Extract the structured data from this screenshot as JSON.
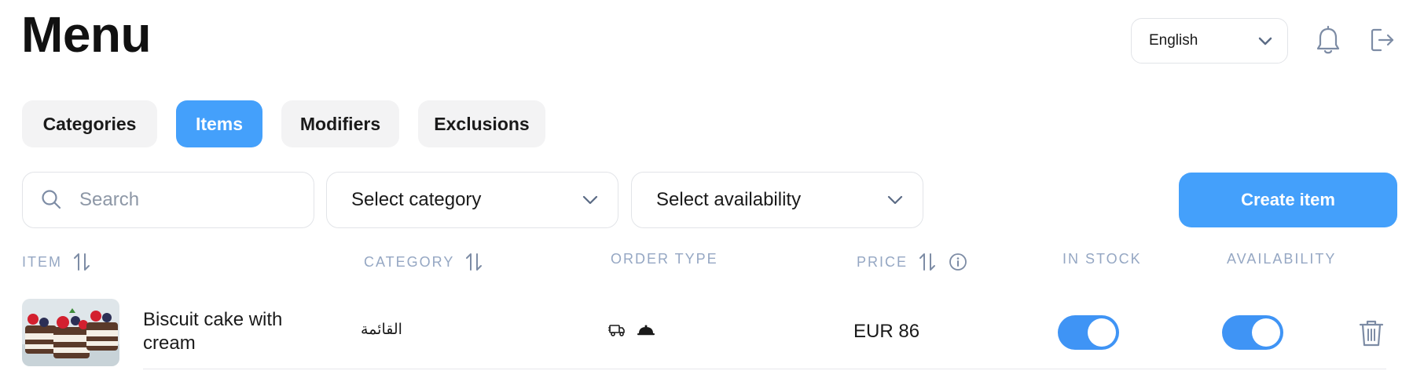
{
  "header": {
    "title": "Menu"
  },
  "language": {
    "selected": "English",
    "icon": "chevron-down-icon"
  },
  "header_actions": {
    "notification_icon": "bell-icon",
    "logout_icon": "logout-icon"
  },
  "tabs": [
    {
      "label": "Categories",
      "active": false
    },
    {
      "label": "Items",
      "active": true
    },
    {
      "label": "Modifiers",
      "active": false
    },
    {
      "label": "Exclusions",
      "active": false
    }
  ],
  "filters": {
    "search_placeholder": "Search",
    "category_placeholder": "Select category",
    "availability_placeholder": "Select availability"
  },
  "actions": {
    "create_label": "Create item"
  },
  "table": {
    "columns": {
      "item": "ITEM",
      "category": "CATEGORY",
      "order_type": "ORDER TYPE",
      "price": "PRICE",
      "in_stock": "IN STOCK",
      "availability": "AVAILABILITY"
    },
    "rows": [
      {
        "name": "Biscuit cake with cream",
        "category": "القائمة",
        "order_type_icons": [
          "delivery-truck-icon",
          "dine-in-cloche-icon"
        ],
        "price": "EUR 86",
        "in_stock": true,
        "available": true
      }
    ]
  },
  "colors": {
    "accent": "#44a0fb",
    "toggle_on": "#3f94f5",
    "header_text": "#95a7c3",
    "tab_bg": "#f3f3f4"
  }
}
